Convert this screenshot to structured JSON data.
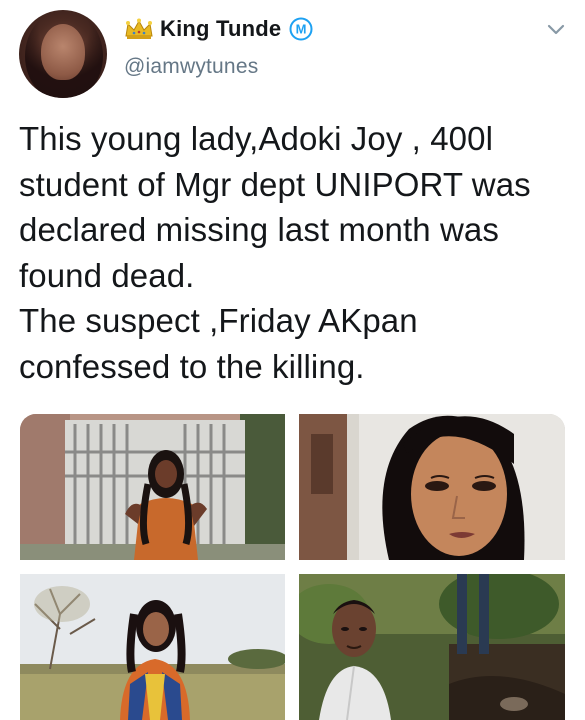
{
  "user": {
    "display_name": "King Tunde",
    "handle": "@iamwytunes",
    "crown_icon": "crown-icon",
    "badge_icon": "m-badge-icon",
    "badge_letter": "M",
    "badge_color": "#1da1f2"
  },
  "tweet": {
    "lines": [
      "This young lady,Adoki Joy , 400l",
      "student of Mgr dept UNIPORT was",
      "declared missing last month was",
      "found dead.",
      "The suspect ,Friday AKpan",
      "confessed to the killing."
    ]
  },
  "media": {
    "count": 4
  },
  "colors": {
    "text": "#14171a",
    "secondary": "#657786",
    "crown": "#e8b923"
  }
}
